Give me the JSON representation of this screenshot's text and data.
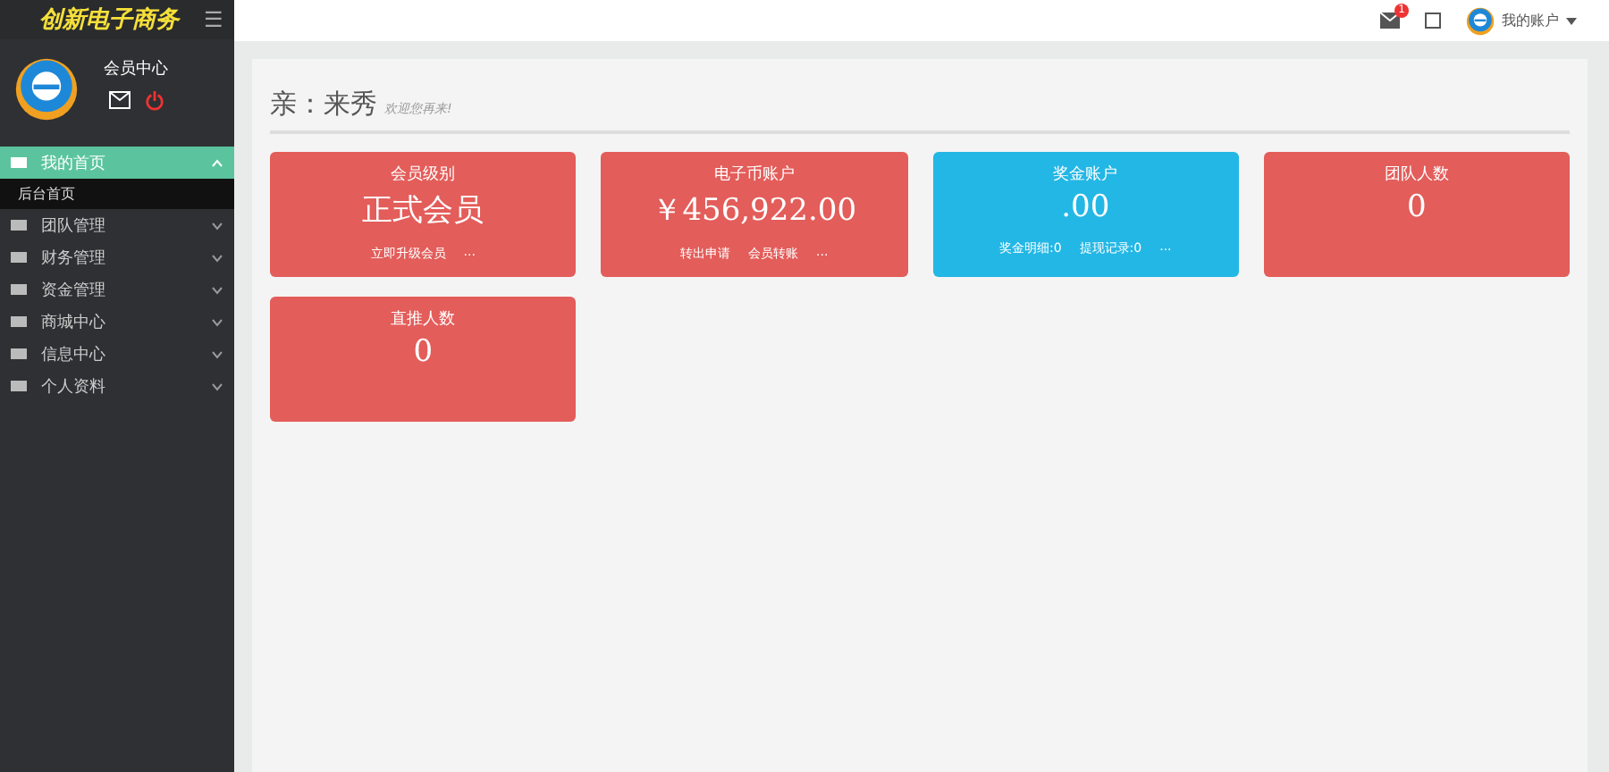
{
  "sidebar": {
    "logo": "创新电子商务",
    "menu_icon": "☰",
    "profile": {
      "title": "会员中心"
    },
    "items": [
      {
        "label": "我的首页",
        "expanded": true,
        "selected": true,
        "children": [
          {
            "label": "后台首页",
            "selected": false
          }
        ]
      },
      {
        "label": "团队管理",
        "expanded": false,
        "selected": false
      },
      {
        "label": "财务管理",
        "expanded": false,
        "selected": false
      },
      {
        "label": "资金管理",
        "expanded": false,
        "selected": false
      },
      {
        "label": "商城中心",
        "expanded": false,
        "selected": false
      },
      {
        "label": "信息中心",
        "expanded": false,
        "selected": false
      },
      {
        "label": "个人资料",
        "expanded": false,
        "selected": false
      }
    ]
  },
  "topbar": {
    "mail_badge": "1",
    "user": "我的账户"
  },
  "greeting": {
    "title": "亲：来秀",
    "subtitle": "欢迎您再来!"
  },
  "cards": [
    {
      "title": "会员级别",
      "value": "正式会员",
      "links": [
        "立即升级会员",
        "..."
      ],
      "color": "#e35d5a"
    },
    {
      "title": "电子币账户",
      "value": "￥456,922.00",
      "links": [
        "转出申请",
        "会员转账",
        "..."
      ],
      "color": "#e35d5a"
    },
    {
      "title": "奖金账户",
      "value": ".00",
      "links": [
        "奖金明细:0",
        "提现记录:0",
        "..."
      ],
      "color": "#23b7e5"
    },
    {
      "title": "团队人数",
      "value": "0",
      "color": "#e35d5a"
    },
    {
      "title": "直推人数",
      "value": "0",
      "color": "#e35d5a"
    }
  ]
}
